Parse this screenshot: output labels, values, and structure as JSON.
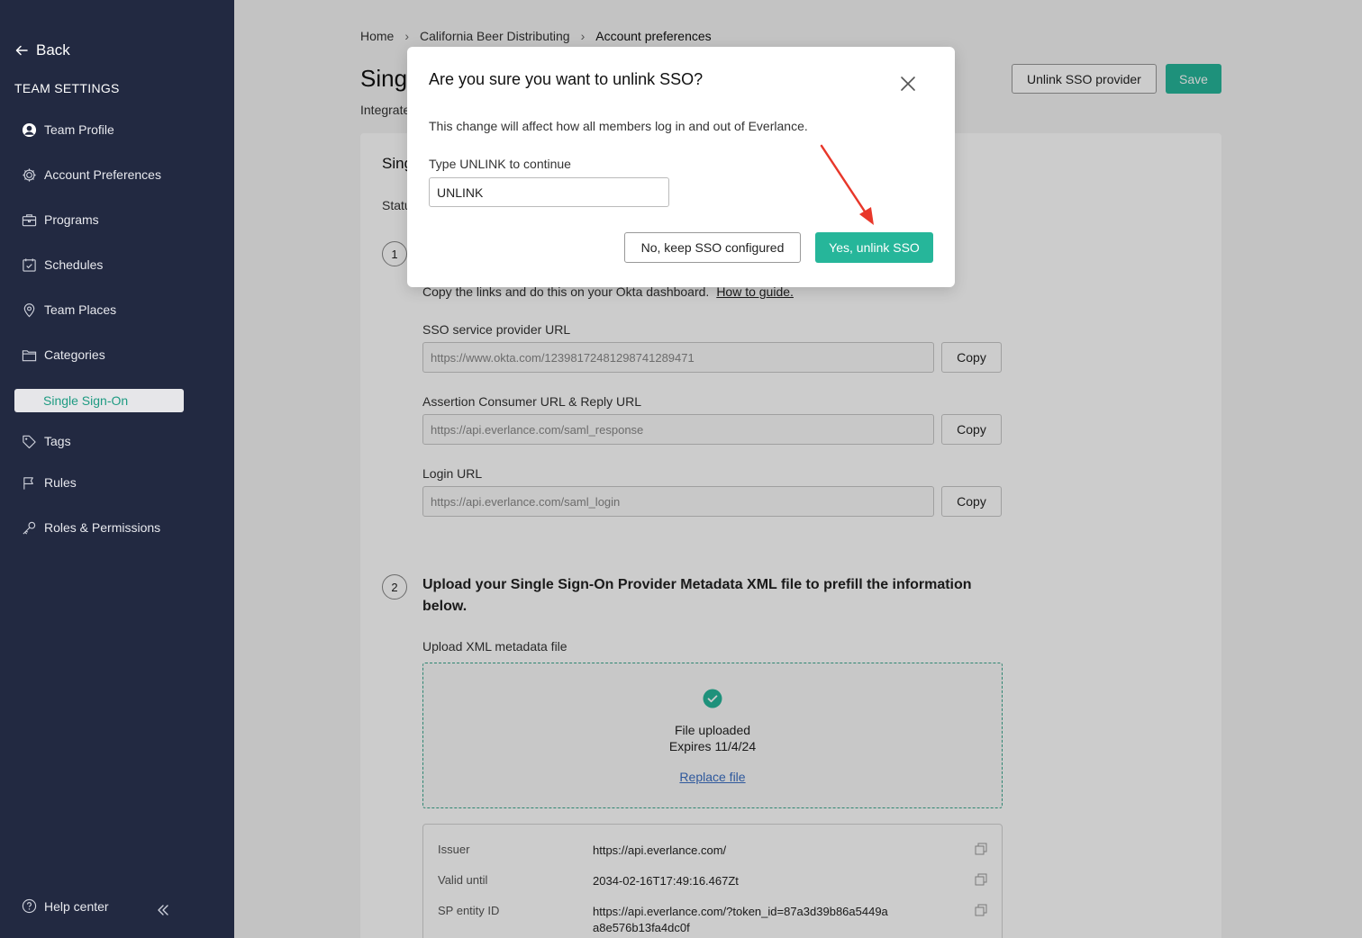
{
  "colors": {
    "sidebar_bg": "#222941",
    "accent": "#26b69a",
    "active_text": "#1e9b82",
    "annotation_arrow": "#e8372a"
  },
  "sidebar": {
    "back_label": "Back",
    "section_title": "TEAM SETTINGS",
    "items": [
      {
        "label": "Team Profile",
        "icon": "user-circle-icon"
      },
      {
        "label": "Account Preferences",
        "icon": "gear-icon"
      },
      {
        "label": "Programs",
        "icon": "briefcase-icon"
      },
      {
        "label": "Schedules",
        "icon": "calendar-check-icon"
      },
      {
        "label": "Team Places",
        "icon": "map-pin-icon"
      },
      {
        "label": "Categories",
        "icon": "folder-icon"
      },
      {
        "label": "Single Sign-On",
        "icon": "",
        "active": true
      },
      {
        "label": "Tags",
        "icon": "tag-icon"
      },
      {
        "label": "Rules",
        "icon": "flag-icon"
      },
      {
        "label": "Roles & Permissions",
        "icon": "key-icon"
      }
    ],
    "help_label": "Help center"
  },
  "breadcrumb": [
    "Home",
    "California Beer Distributing",
    "Account preferences"
  ],
  "page": {
    "title": "Single",
    "subtitle": "Integrate",
    "unlink_button": "Unlink SSO provider",
    "save_button": "Save"
  },
  "card": {
    "title": "Sing",
    "status": "Statu",
    "step1": {
      "number": "1",
      "instruction": "Copy the links and do this on your Okta dashboard.",
      "guide_link": "How to guide.",
      "fields": [
        {
          "label": "SSO service provider URL",
          "value": "https://www.okta.com/12398172481298741289471",
          "copy": "Copy"
        },
        {
          "label": "Assertion Consumer URL & Reply URL",
          "value": "https://api.everlance.com/saml_response",
          "copy": "Copy"
        },
        {
          "label": "Login URL",
          "value": "https://api.everlance.com/saml_login",
          "copy": "Copy"
        }
      ]
    },
    "step2": {
      "number": "2",
      "title": "Upload your Single Sign-On Provider Metadata XML file to prefill the information below.",
      "upload_label": "Upload XML metadata file",
      "upload_status": "File uploaded",
      "expires": "Expires 11/4/24",
      "replace_link": "Replace file"
    },
    "metadata": [
      {
        "key": "Issuer",
        "value": "https://api.everlance.com/"
      },
      {
        "key": "Valid until",
        "value": "2034-02-16T17:49:16.467Zt"
      },
      {
        "key": "SP entity ID",
        "value": "https://api.everlance.com/?token_id=87a3d39b86a5449aa8e576b13fa4dc0f"
      }
    ]
  },
  "modal": {
    "title": "Are you sure you want to unlink SSO?",
    "description": "This change will affect how all members log in and out of Everlance.",
    "input_label": "Type UNLINK to continue",
    "input_value": "UNLINK",
    "cancel_button": "No, keep SSO configured",
    "confirm_button": "Yes, unlink SSO"
  }
}
